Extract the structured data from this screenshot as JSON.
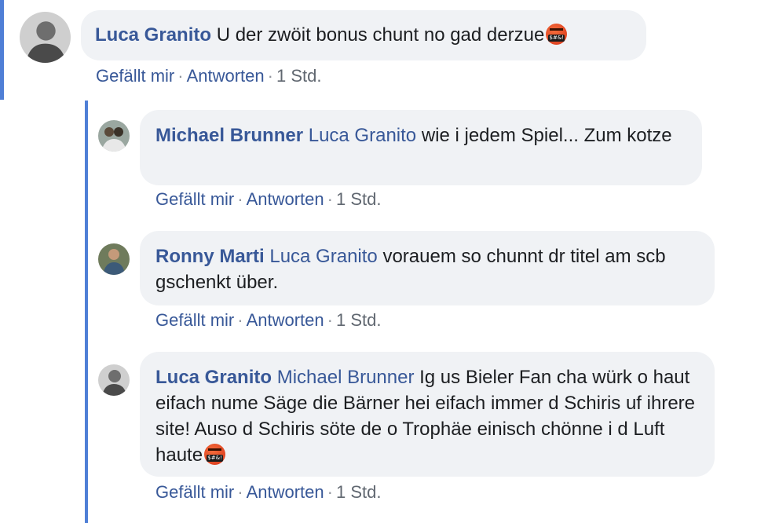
{
  "comments": [
    {
      "author": "Luca Granito",
      "mention": "",
      "text": "U der zwöit bonus chunt no gad derzue",
      "emoji": "angry-censored-emoji",
      "actions": {
        "like": "Gefällt mir",
        "reply": "Antworten",
        "time": "1 Std."
      }
    },
    {
      "author": "Michael Brunner",
      "mention": "Luca Granito",
      "text": "wie i jedem Spiel... Zum kotze",
      "emoji": "",
      "actions": {
        "like": "Gefällt mir",
        "reply": "Antworten",
        "time": "1 Std."
      }
    },
    {
      "author": "Ronny Marti",
      "mention": "Luca Granito",
      "text": "vorauem so chunnt dr titel am scb gschenkt über.",
      "emoji": "",
      "actions": {
        "like": "Gefällt mir",
        "reply": "Antworten",
        "time": "1 Std."
      }
    },
    {
      "author": "Luca Granito",
      "mention": "Michael Brunner",
      "text": "Ig us Bieler Fan cha würk o haut eifach nume Säge die Bärner hei eifach immer d Schiris uf ihrere site! Auso d Schiris söte de o Trophäe einisch chönne i d Luft haute",
      "emoji": "angry-censored-emoji",
      "actions": {
        "like": "Gefällt mir",
        "reply": "Antworten",
        "time": "1 Std."
      }
    }
  ],
  "colors": {
    "accent": "#4f7fd6",
    "link": "#385898",
    "bubble": "#f0f2f5",
    "meta": "#606770"
  }
}
